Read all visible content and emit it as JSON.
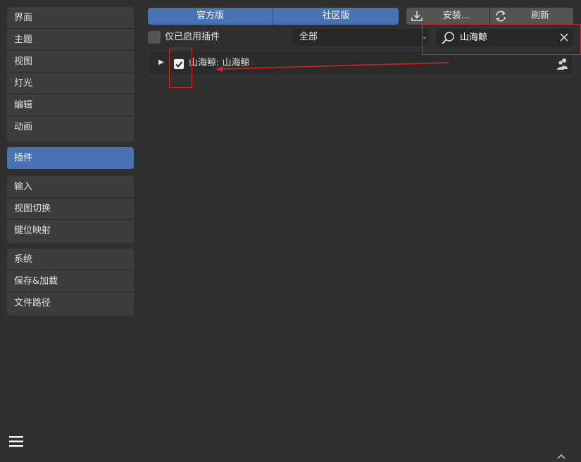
{
  "sidebar": {
    "group1": [
      "界面",
      "主题",
      "视图",
      "灯光",
      "编辑",
      "动画"
    ],
    "active": "插件",
    "group3": [
      "输入",
      "视图切换",
      "键位映射"
    ],
    "group4": [
      "系统",
      "保存&加载",
      "文件路径"
    ]
  },
  "tabs": {
    "official": "官方版",
    "community": "社区版"
  },
  "actions": {
    "install": "安装...",
    "refresh": "刷新"
  },
  "filter": {
    "enabled_only_label": "仅已启用插件",
    "category_value": "全部"
  },
  "search": {
    "value": "山海鲸"
  },
  "addon": {
    "name": "山海鲸: 山海鲸",
    "enabled": true
  },
  "colors": {
    "accent": "#4772b3",
    "annotation": "#e02020",
    "background": "#303030"
  }
}
